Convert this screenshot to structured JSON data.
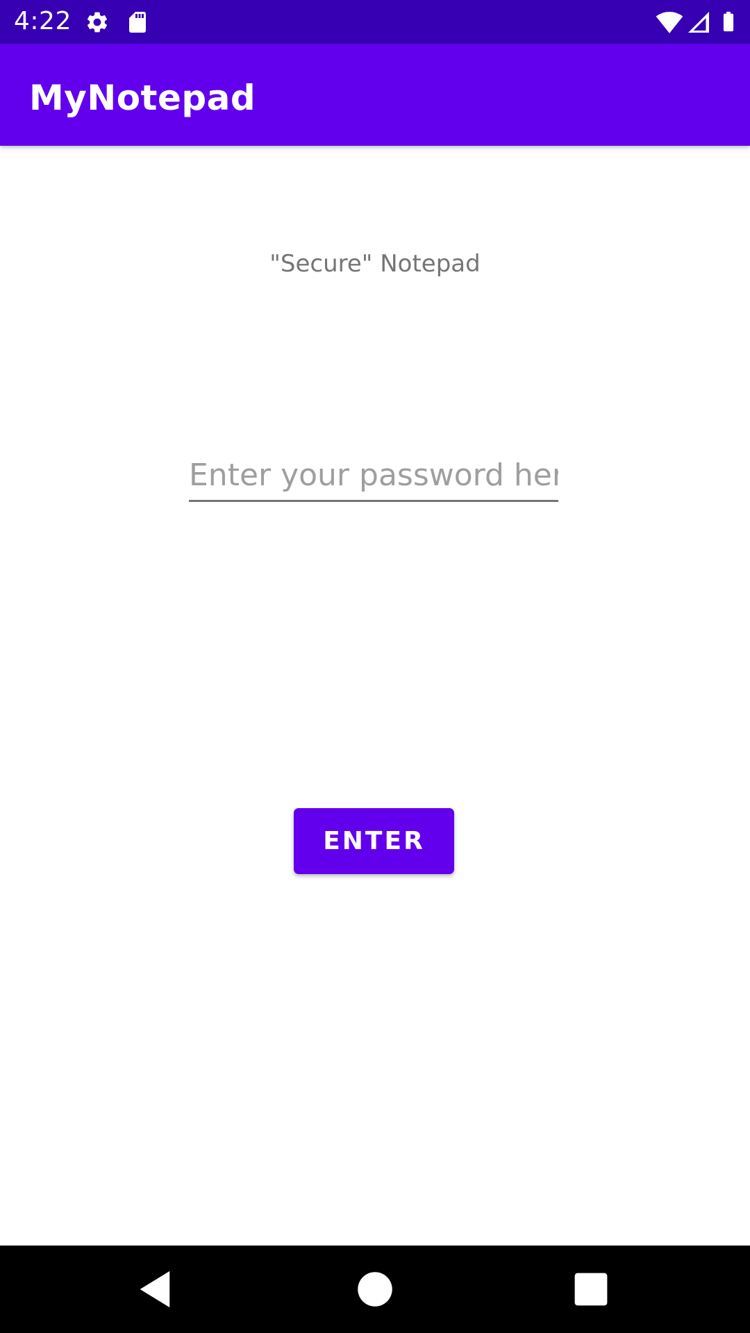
{
  "status_bar": {
    "time": "4:22",
    "icons": [
      "settings-icon",
      "sd-card-icon",
      "wifi-icon",
      "cell-signal-icon",
      "battery-icon"
    ],
    "background": "#3700b3"
  },
  "app_bar": {
    "title": "MyNotepad",
    "background": "#6200ee"
  },
  "main": {
    "subtitle": "\"Secure\" Notepad",
    "password": {
      "value": "",
      "placeholder": "Enter your password here"
    },
    "enter_button_label": "ENTER"
  },
  "nav_bar": {
    "buttons": [
      "back-icon",
      "home-icon",
      "recents-icon"
    ]
  },
  "colors": {
    "primary": "#6200ee",
    "primary_dark": "#3700b3"
  }
}
